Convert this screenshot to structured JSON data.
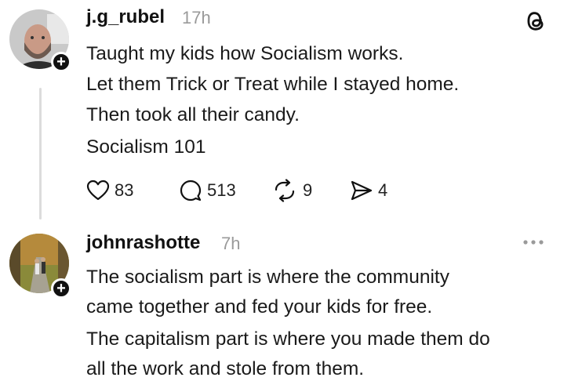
{
  "post": {
    "username": "j.g_rubel",
    "time": "17h",
    "lines": [
      "Taught my kids how Socialism works.",
      "Let them Trick or Treat while I stayed home.",
      "Then took all their candy.",
      "Socialism 101"
    ],
    "likes": "83",
    "replies": "513",
    "reposts": "9",
    "shares": "4"
  },
  "reply": {
    "username": "johnrashotte",
    "time": "7h",
    "lines": [
      "The socialism part is where the community",
      "came together and fed your kids for free.",
      "The capitalism part is where you made them do",
      "all the work and stole from them."
    ]
  },
  "icons": {
    "brand": "threads-icon",
    "like": "heart-icon",
    "reply": "comment-icon",
    "repost": "repost-icon",
    "share": "send-icon",
    "follow": "plus-icon",
    "more": "more-icon"
  }
}
